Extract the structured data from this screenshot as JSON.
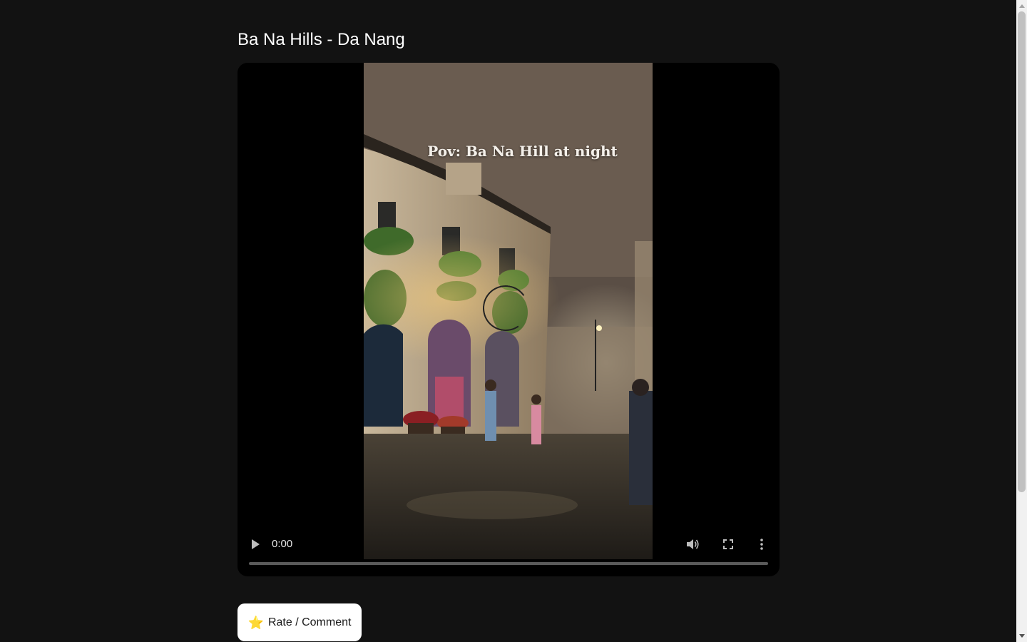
{
  "page": {
    "title": "Ba Na Hills - Da Nang"
  },
  "video": {
    "overlay_caption": "Pov: Ba Na Hill at night",
    "current_time": "0:00",
    "progress": 0,
    "icons": {
      "play": "play-icon",
      "volume": "volume-icon",
      "fullscreen": "fullscreen-icon",
      "more": "more-vertical-icon",
      "loading": "loading-spinner-icon"
    }
  },
  "actions": {
    "rate_label": "Rate / Comment",
    "rate_icon": "⭐"
  },
  "colors": {
    "background": "#121212",
    "player_background": "#000000",
    "button_background": "#ffffff",
    "star": "#f5b301"
  }
}
